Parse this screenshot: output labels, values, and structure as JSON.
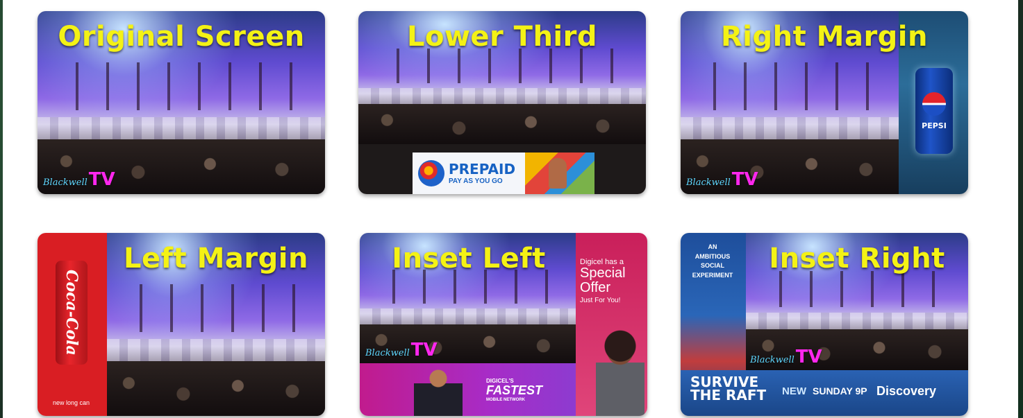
{
  "tiles": [
    {
      "title": "Original Screen",
      "tv_script": "Blackwell",
      "tv_label": "TV"
    },
    {
      "title": "Lower Third",
      "ad": {
        "headline": "PREPAID",
        "subline": "PAY AS YOU GO"
      }
    },
    {
      "title": "Right Margin",
      "ad": {
        "brand": "PEPSI"
      },
      "tv_script": "Blackwell",
      "tv_label": "TV"
    },
    {
      "title": "Left Margin",
      "ad": {
        "brand": "Coca-Cola",
        "footer": "new long can"
      }
    },
    {
      "title": "Inset Left",
      "side_ad": {
        "line1": "Digicel has a",
        "line2": "Special",
        "line3": "Offer",
        "line4": "Just For You!"
      },
      "bottom_ad": {
        "small": "DIGICEL'S",
        "big": "FASTEST",
        "sub": "MOBILE NETWORK"
      },
      "tv_script": "Blackwell",
      "tv_label": "TV"
    },
    {
      "title": "Inset Right",
      "side_ad": {
        "line1": "AN",
        "line2": "AMBITIOUS",
        "line3": "SOCIAL",
        "line4": "EXPERIMENT"
      },
      "bottom_ad": {
        "show_line1": "SURVIVE",
        "show_line2": "THE RAFT",
        "new": "NEW",
        "time": "SUNDAY 9P",
        "network": "Discovery"
      },
      "tv_script": "Blackwell",
      "tv_label": "TV"
    }
  ]
}
